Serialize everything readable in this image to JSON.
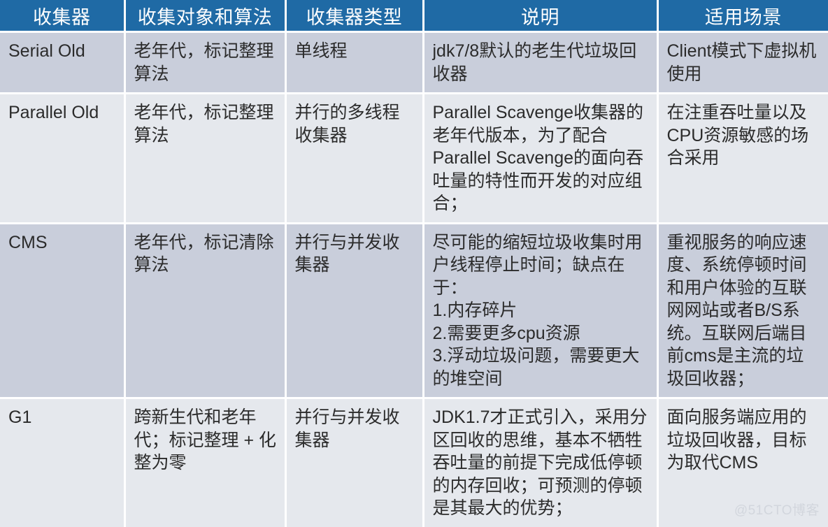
{
  "table": {
    "columns": [
      {
        "key": "collector",
        "label": "收集器"
      },
      {
        "key": "target_algo",
        "label": "收集对象和算法"
      },
      {
        "key": "type",
        "label": "收集器类型"
      },
      {
        "key": "description",
        "label": "说明"
      },
      {
        "key": "scenario",
        "label": "适用场景"
      }
    ],
    "rows": [
      {
        "collector": "Serial Old",
        "target_algo": "老年代，标记整理算法",
        "type": "单线程",
        "description": "jdk7/8默认的老生代垃圾回收器",
        "scenario": "Client模式下虚拟机使用"
      },
      {
        "collector": "Parallel Old",
        "target_algo": "老年代，标记整理算法",
        "type": "并行的多线程收集器",
        "description": "Parallel Scavenge收集器的老年代版本，为了配合Parallel Scavenge的面向吞吐量的特性而开发的对应组合；",
        "scenario": "在注重吞吐量以及CPU资源敏感的场合采用"
      },
      {
        "collector": "CMS",
        "target_algo": "老年代，标记清除算法",
        "type": "并行与并发收集器",
        "description": "尽可能的缩短垃圾收集时用户线程停止时间；缺点在于：\n1.内存碎片\n2.需要更多cpu资源\n3.浮动垃圾问题，需要更大的堆空间",
        "scenario": "重视服务的响应速度、系统停顿时间和用户体验的互联网网站或者B/S系统。互联网后端目前cms是主流的垃圾回收器；"
      },
      {
        "collector": "G1",
        "target_algo": "跨新生代和老年代；标记整理 + 化整为零",
        "type": "并行与并发收集器",
        "description": "JDK1.7才正式引入，采用分区回收的思维，基本不牺牲吞吐量的前提下完成低停顿的内存回收；可预测的停顿是其最大的优势；",
        "scenario": "面向服务端应用的垃圾回收器，目标为取代CMS"
      }
    ]
  },
  "watermark": {
    "text": "@51CTO博客"
  },
  "colors": {
    "header_bg": "#1f6aa5",
    "header_text": "#ffffff",
    "row_dark_bg": "#c9cedb",
    "row_light_bg": "#e5e8ed",
    "body_text": "#2b2b2b",
    "grid_line": "#ffffff",
    "watermark_text": "#d2d6dd"
  }
}
